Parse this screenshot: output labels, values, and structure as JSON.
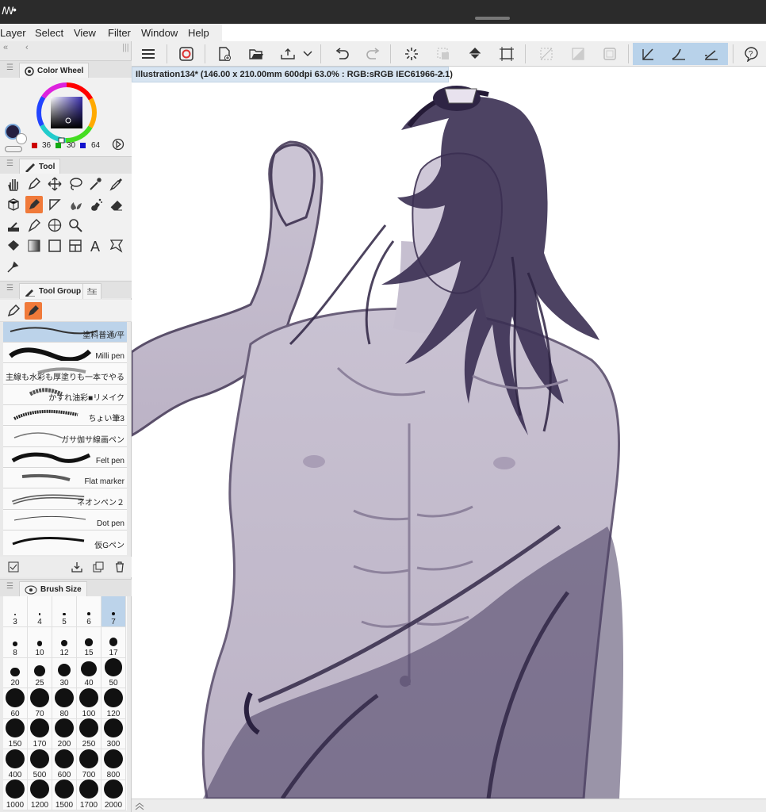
{
  "menu": {
    "items": [
      "Layer",
      "Select",
      "View",
      "Filter",
      "Window",
      "Help"
    ]
  },
  "document": {
    "title": "Illustration134* (146.00 x 210.00mm 600dpi 63.0% : RGB:sRGB IEC61966-2.1)"
  },
  "color_wheel": {
    "panel_label": "Color Wheel",
    "r": "36",
    "g": "30",
    "b": "64",
    "current_color": "#241e40"
  },
  "tool_panel": {
    "label": "Tool",
    "selected": "pen"
  },
  "tool_group": {
    "label": "Tool Group",
    "brushes": [
      {
        "label": "塗料普通/平",
        "selected": true
      },
      {
        "label": "Milli pen"
      },
      {
        "label": "主線も水彩も厚塗りも一本でやる"
      },
      {
        "label": "かすれ油彩■リメイク"
      },
      {
        "label": "ちょい筆3"
      },
      {
        "label": "ガサ伽サ線画ペン"
      },
      {
        "label": "Felt pen"
      },
      {
        "label": "Flat marker"
      },
      {
        "label": "ネオンペン２"
      },
      {
        "label": "Dot pen"
      },
      {
        "label": "仮Gペン"
      }
    ]
  },
  "brush_size": {
    "label": "Brush Size",
    "selected": "7",
    "sizes": [
      "3",
      "4",
      "5",
      "6",
      "7",
      "8",
      "10",
      "12",
      "15",
      "17",
      "20",
      "25",
      "30",
      "40",
      "50",
      "60",
      "70",
      "80",
      "100",
      "120",
      "150",
      "170",
      "200",
      "250",
      "300",
      "400",
      "500",
      "600",
      "700",
      "800",
      "1000",
      "1200",
      "1500",
      "1700",
      "2000"
    ]
  },
  "accent_color": "#f07a3a",
  "selection_color": "#bcd3ea"
}
